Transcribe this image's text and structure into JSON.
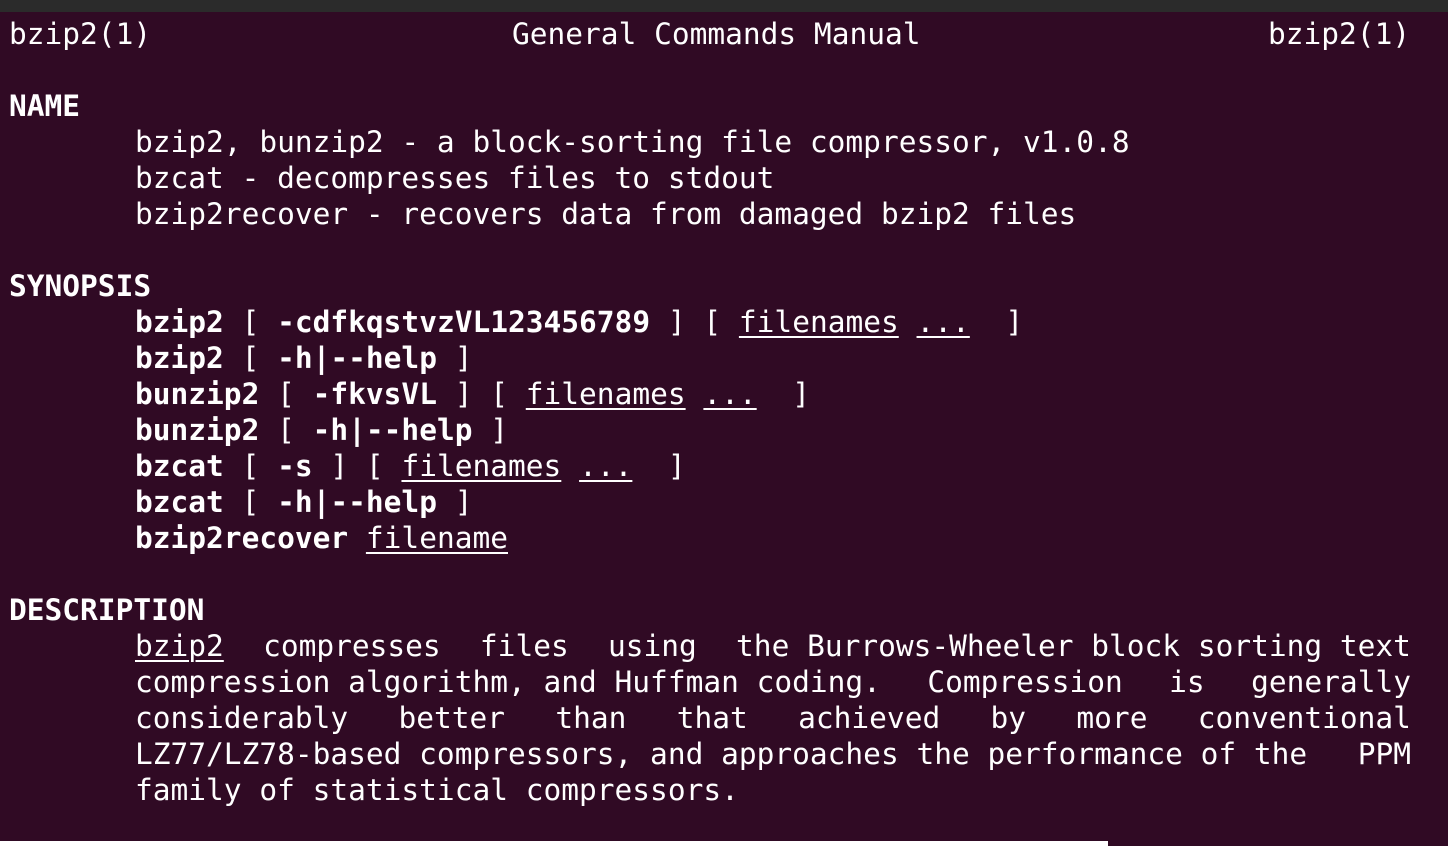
{
  "header": {
    "left": "bzip2(1)",
    "center": "General Commands Manual",
    "right": "bzip2(1)"
  },
  "name_section": {
    "heading": "NAME",
    "lines": [
      "bzip2, bunzip2 - a block-sorting file compressor, v1.0.8",
      "bzcat - decompresses files to stdout",
      "bzip2recover - recovers data from damaged bzip2 files"
    ]
  },
  "synopsis": {
    "heading": "SYNOPSIS",
    "l1": {
      "cmd": "bzip2",
      "p1": " [ ",
      "opt": "-cdfkqstvzVL123456789",
      "p2": " ] [ ",
      "arg": "filenames",
      "sp": " ",
      "ell": "...",
      "p3": "  ]"
    },
    "l2": {
      "cmd": "bzip2",
      "p1": " [ ",
      "opt": "-h|--help",
      "p2": " ]"
    },
    "l3": {
      "cmd": "bunzip2",
      "p1": " [ ",
      "opt": "-fkvsVL",
      "p2": " ] [ ",
      "arg": "filenames",
      "sp": " ",
      "ell": "...",
      "p3": "  ]"
    },
    "l4": {
      "cmd": "bunzip2",
      "p1": " [ ",
      "opt": "-h|--help",
      "p2": " ]"
    },
    "l5": {
      "cmd": "bzcat",
      "p1": " [ ",
      "opt": "-s",
      "p2": " ] [ ",
      "arg": "filenames",
      "sp": " ",
      "ell": "...",
      "p3": "  ]"
    },
    "l6": {
      "cmd": "bzcat",
      "p1": " [ ",
      "opt": "-h|--help",
      "p2": " ]"
    },
    "l7": {
      "cmd": "bzip2recover",
      "sp": " ",
      "arg": "filename"
    }
  },
  "description": {
    "heading": "DESCRIPTION",
    "line1_words": [
      "bzip2",
      "compresses",
      "files",
      "using",
      "the Burrows-Wheeler block sorting text"
    ],
    "line2_words": [
      "compression algorithm, and Huffman coding.",
      "Compression",
      "is",
      "generally"
    ],
    "line3_words": [
      "considerably",
      "better",
      "than",
      "that",
      "achieved",
      "by",
      "more",
      "conventional"
    ],
    "line4_words": [
      "LZ77/LZ78-based compressors, and approaches the performance of the",
      "PPM"
    ],
    "line5": "family of statistical compressors."
  }
}
